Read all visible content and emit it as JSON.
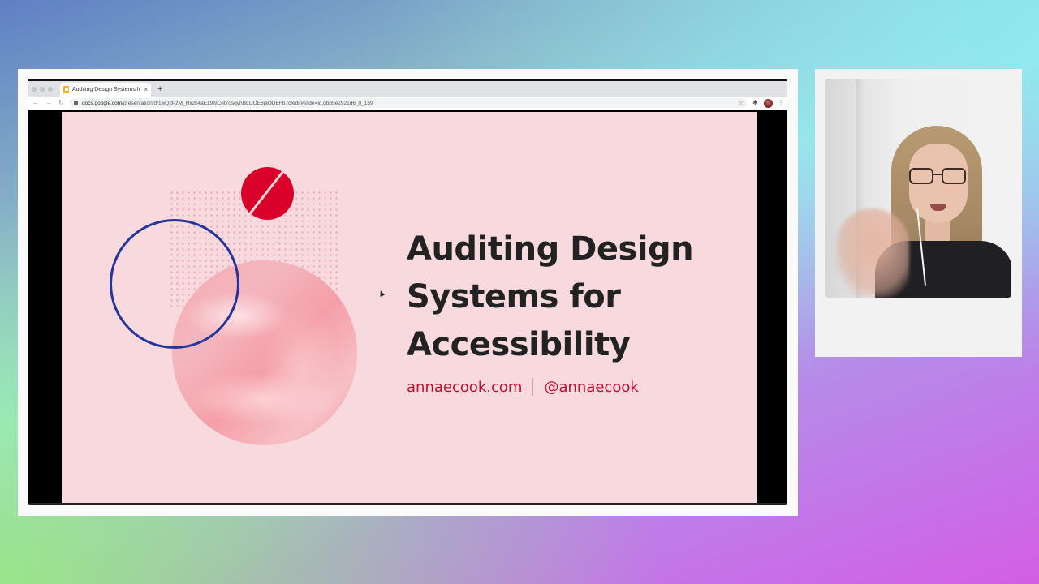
{
  "browser": {
    "tab_title": "Auditing Design Systems for A",
    "tab_close": "×",
    "new_tab": "+",
    "url_domain": "docs.google.com",
    "url_path": "/presentation/d/1wQ2PzM_Hx2k4aE19I9Cet7osqyhBLtJOE6jaODEFb7c/edit#slide=id.gbb5e2921d6_0_159",
    "nav_back": "←",
    "nav_forward": "→",
    "nav_reload": "↻",
    "star": "☆",
    "extensions": "✱",
    "menu": "⋮"
  },
  "slide": {
    "title_line1": "Auditing Design",
    "title_line2": "Systems for",
    "title_line3": "Accessibility",
    "website": "annaecook.com",
    "handle": "@annaecook",
    "accent_color": "#c0102f",
    "background_color": "#f7d9de",
    "ring_color": "#23349a",
    "red_circle_color": "#d9002a"
  },
  "icons": {
    "tab_favicon": "google-slides-icon",
    "lock": "lock-icon",
    "star": "star-icon",
    "extensions": "puzzle-icon",
    "profile": "avatar-icon",
    "menu": "kebab-menu-icon"
  }
}
